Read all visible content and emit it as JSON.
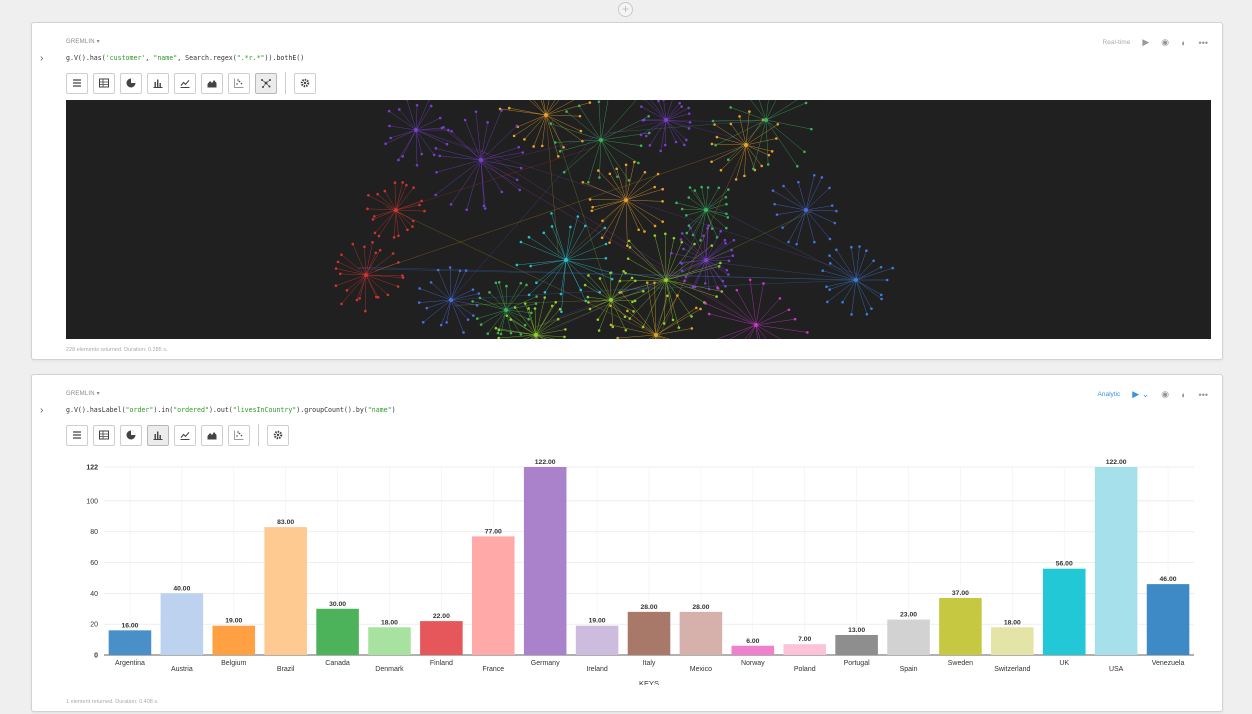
{
  "paragraphs": [
    {
      "interpreter": "GREMLIN ▾",
      "code_parts": [
        {
          "t": "g.V().has(",
          "c": ""
        },
        {
          "t": "'customer'",
          "c": "s"
        },
        {
          "t": ", ",
          "c": ""
        },
        {
          "t": "\"name\"",
          "c": "s"
        },
        {
          "t": ", Search.regex(",
          "c": ""
        },
        {
          "t": "\".*r.*\"",
          "c": "s"
        },
        {
          "t": ")).bothE()",
          "c": ""
        }
      ],
      "status": "Real-time",
      "footer": "228 elements returned. Duration: 0.285 s."
    },
    {
      "interpreter": "GREMLIN ▾",
      "code_parts": [
        {
          "t": "g.V().hasLabel(",
          "c": ""
        },
        {
          "t": "\"order\"",
          "c": "s"
        },
        {
          "t": ").in(",
          "c": ""
        },
        {
          "t": "\"ordered\"",
          "c": "s"
        },
        {
          "t": ").out(",
          "c": ""
        },
        {
          "t": "\"livesInCountry\"",
          "c": "s"
        },
        {
          "t": ").groupCount().by(",
          "c": ""
        },
        {
          "t": "\"name\"",
          "c": "s"
        },
        {
          "t": ")",
          "c": ""
        }
      ],
      "status": "Analytic",
      "footer": "1 element returned. Duration: 0.408 s."
    }
  ],
  "icons": [
    "list-icon",
    "table-icon",
    "pie-chart-icon",
    "bar-chart-icon",
    "line-chart-icon",
    "area-chart-icon",
    "scatter-icon",
    "network-icon",
    "gear-icon"
  ],
  "graph_colors": [
    "#e8a22b",
    "#3ab35a",
    "#7a3fd1",
    "#d2332e",
    "#4a6fe0",
    "#27c2c9",
    "#8ed12a",
    "#cf36c9",
    "#3b7dd8",
    "#d6a82a"
  ],
  "chart_data": {
    "type": "bar",
    "xlabel": "KEYS",
    "ylabel": "",
    "ylim": [
      0,
      122
    ],
    "yticks": [
      0,
      20,
      40,
      60,
      80,
      100,
      122
    ],
    "categories": [
      "Argentina",
      "Austria",
      "Belgium",
      "Brazil",
      "Canada",
      "Denmark",
      "Finland",
      "France",
      "Germany",
      "Ireland",
      "Italy",
      "Mexico",
      "Norway",
      "Poland",
      "Portugal",
      "Spain",
      "Sweden",
      "Switzerland",
      "UK",
      "USA",
      "Venezuela"
    ],
    "values": [
      16,
      40,
      19,
      83,
      30,
      18,
      22,
      77,
      122,
      19,
      28,
      28,
      6,
      7,
      13,
      23,
      37,
      18,
      56,
      122,
      46
    ],
    "value_labels": [
      "16.00",
      "40.00",
      "19.00",
      "83.00",
      "30.00",
      "18.00",
      "22.00",
      "77.00",
      "122.00",
      "19.00",
      "28.00",
      "28.00",
      "6.00",
      "7.00",
      "13.00",
      "23.00",
      "37.00",
      "18.00",
      "56.00",
      "122.00",
      "46.00"
    ],
    "colors": [
      "#4a90c8",
      "#bcd2ee",
      "#ffa042",
      "#ffc992",
      "#4db35a",
      "#a8e2a0",
      "#e5575a",
      "#ffaaa8",
      "#aa82cc",
      "#cdbcde",
      "#a87868",
      "#d6b1ab",
      "#ee80cc",
      "#fcc2d8",
      "#8e8e8e",
      "#d2d2d2",
      "#c6c842",
      "#e4e4a6",
      "#22c8d6",
      "#a6e0ea",
      "#3d8ac6"
    ]
  }
}
